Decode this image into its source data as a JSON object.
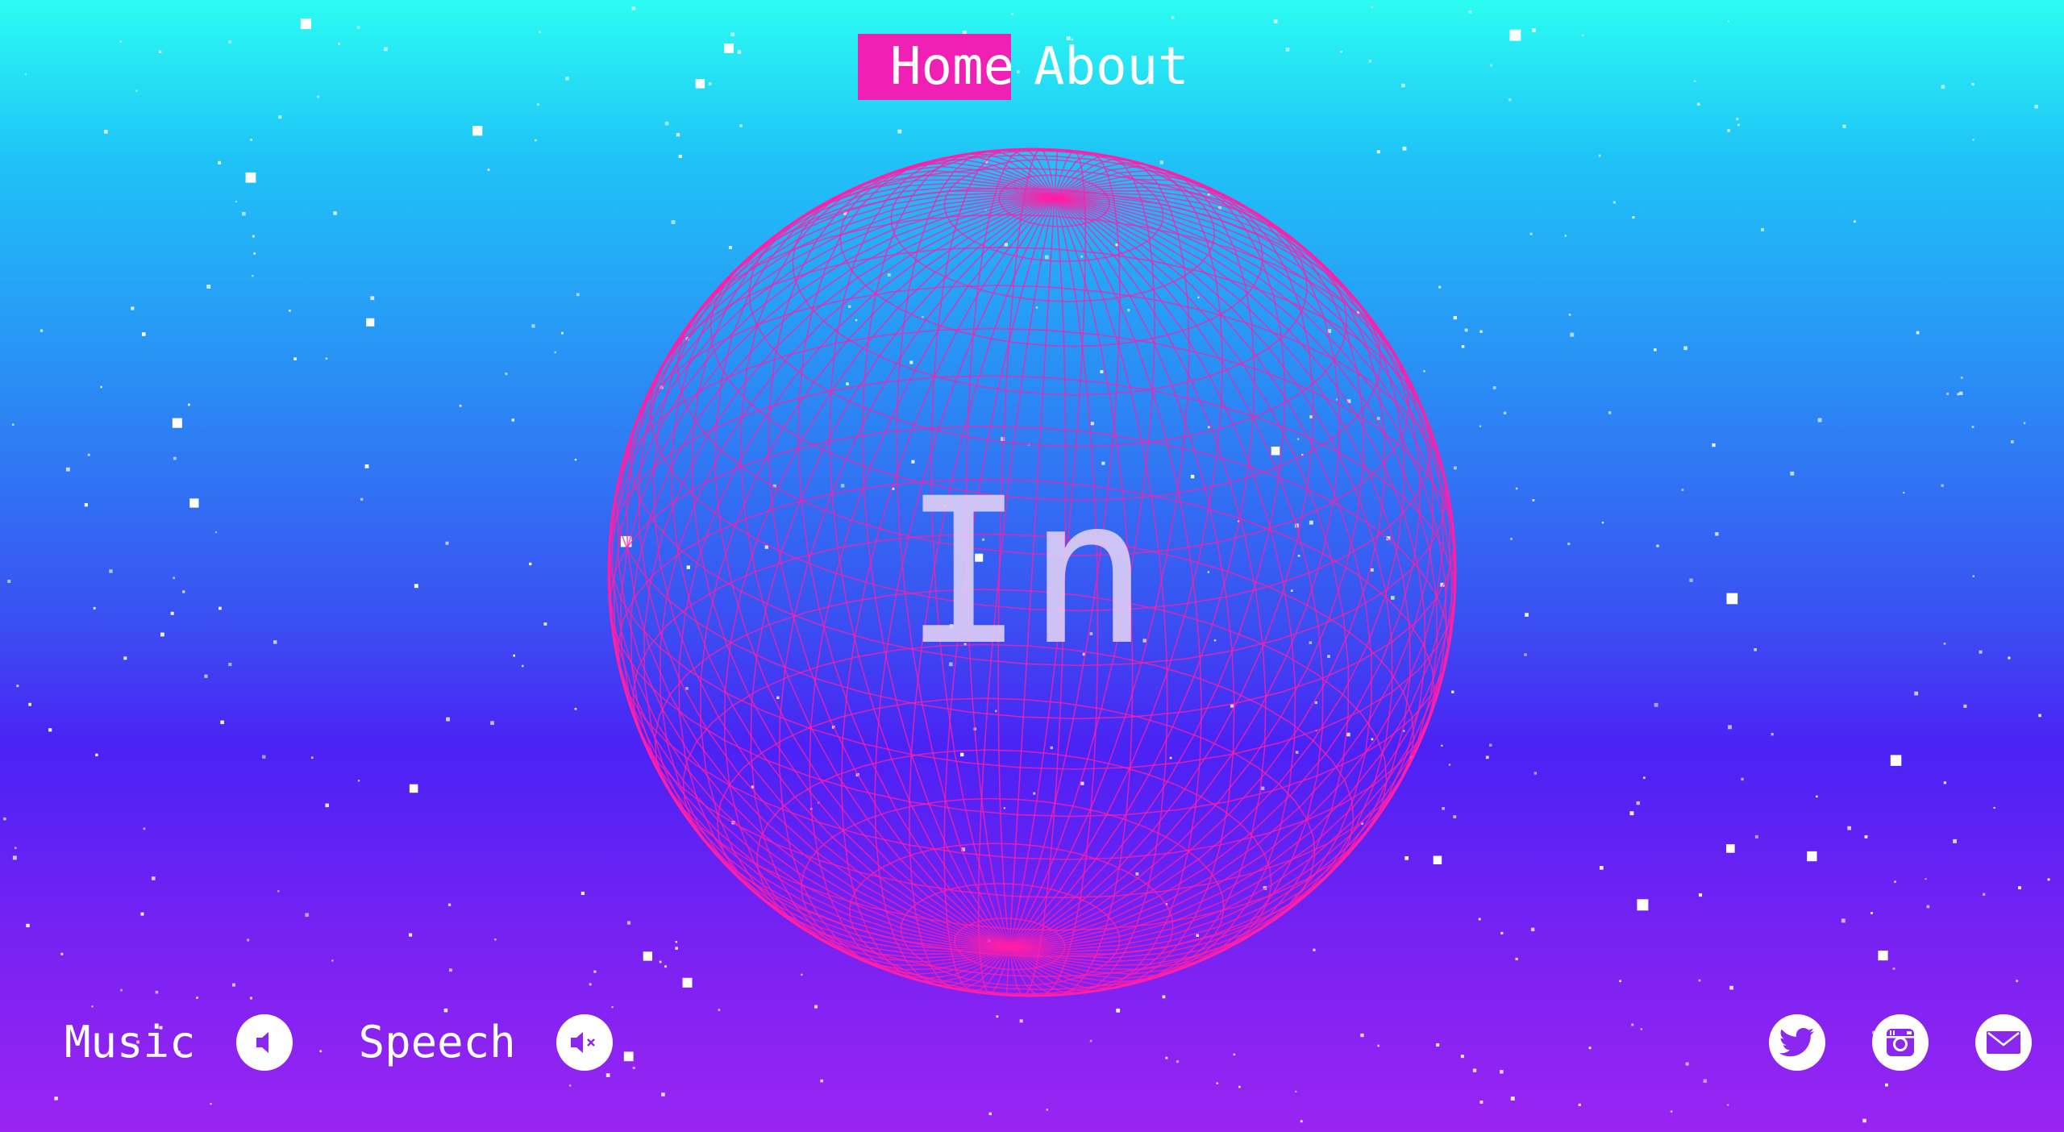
{
  "nav": {
    "items": [
      {
        "label": "Home",
        "active": true
      },
      {
        "label": "About",
        "active": false
      }
    ]
  },
  "hero": {
    "word": "In"
  },
  "controls": {
    "music_label": "Music",
    "music_icon": "speaker-on-icon",
    "speech_label": "Speech",
    "speech_icon": "speaker-muted-icon"
  },
  "social": [
    "twitter-icon",
    "instagram-icon",
    "mail-icon"
  ],
  "colors": {
    "accent": "#f020b4",
    "sphere_lines": "#ff1fa8",
    "gradient_top": "#2bfcf2",
    "gradient_mid": "#3a4ff2",
    "gradient_bottom": "#9a24f2"
  }
}
